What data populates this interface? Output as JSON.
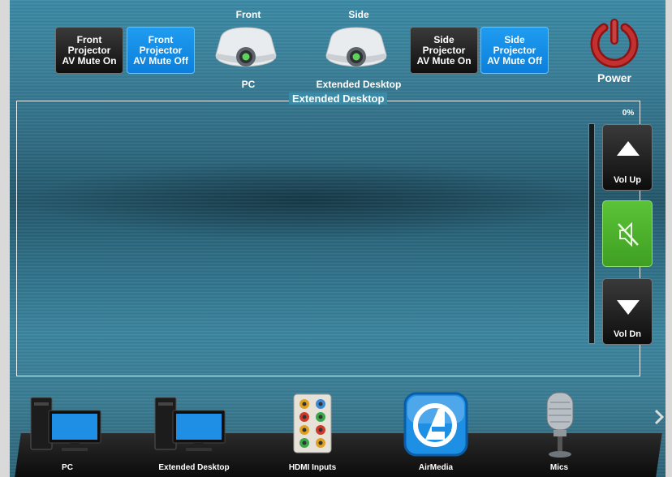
{
  "projectors": {
    "front": {
      "title": "Front",
      "source": "PC"
    },
    "side": {
      "title": "Side",
      "source": "Extended Desktop"
    }
  },
  "buttons": {
    "front_mute_on": "Front\nProjector\nAV Mute On",
    "front_mute_off": "Front\nProjector\nAV Mute Off",
    "side_mute_on": "Side\nProjector\nAV Mute On",
    "side_mute_off": "Side\nProjector\nAV Mute Off"
  },
  "power": {
    "label": "Power",
    "color": "#a31d1d"
  },
  "display": {
    "title": "Extended Desktop"
  },
  "volume": {
    "level_text": "0%",
    "level_fraction": 0.0,
    "up_label": "Vol Up",
    "down_label": "Vol Dn",
    "mute_active": true,
    "mute_color": "#4fb22d"
  },
  "sources": [
    {
      "label": "PC",
      "icon": "desktop-computer-icon"
    },
    {
      "label": "Extended Desktop",
      "icon": "desktop-computer-icon"
    },
    {
      "label": "HDMI Inputs",
      "icon": "hdmi-jacks-icon"
    },
    {
      "label": "AirMedia",
      "icon": "airmedia-icon"
    },
    {
      "label": "Mics",
      "icon": "microphone-icon"
    }
  ]
}
